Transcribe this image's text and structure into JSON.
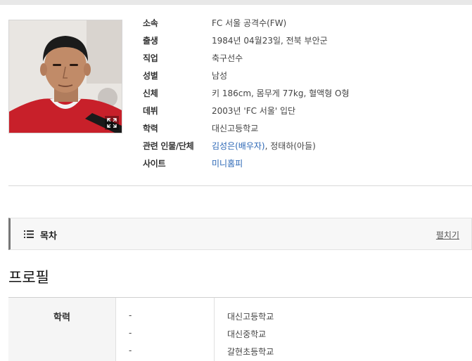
{
  "profile_card": {
    "rows": [
      {
        "label": "소속",
        "value": "FC 서울 공격수(FW)"
      },
      {
        "label": "출생",
        "value": "1984년 04월23일, 전북 부안군"
      },
      {
        "label": "직업",
        "value": "축구선수"
      },
      {
        "label": "성별",
        "value": "남성"
      },
      {
        "label": "신체",
        "value": "키 186cm, 몸무게 77kg, 혈액형 O형"
      },
      {
        "label": "데뷔",
        "value": "2003년 'FC 서울' 입단"
      },
      {
        "label": "학력",
        "value": "대신고등학교"
      },
      {
        "label": "관련 인물/단체",
        "value_link": "김성은(배우자)",
        "value_rest": ", 정태하(아들)"
      },
      {
        "label": "사이트",
        "value_link": "미니홈피"
      }
    ]
  },
  "toc": {
    "title": "목차",
    "toggle_label": "펼치기",
    "icon": "list-icon"
  },
  "section": {
    "title": "프로필"
  },
  "profile_table": {
    "header": "학력",
    "dash": "-",
    "entries": [
      "대신고등학교",
      "대신중학교",
      "갈현초등학교"
    ]
  },
  "colors": {
    "link": "#2a66b5",
    "jersey_red": "#c8202a"
  }
}
